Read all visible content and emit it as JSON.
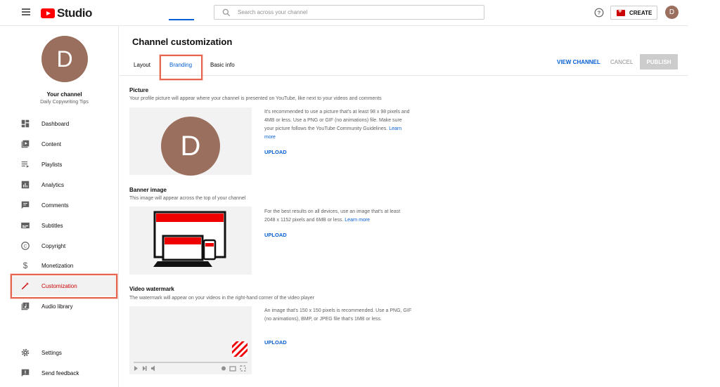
{
  "header": {
    "logo_text": "Studio",
    "search_placeholder": "Search across your channel",
    "create_label": "CREATE",
    "avatar_letter": "D"
  },
  "sidebar": {
    "avatar_letter": "D",
    "your_channel": "Your channel",
    "channel_name": "Daily Copywriting Tips",
    "items": [
      {
        "label": "Dashboard",
        "icon": "dashboard-icon"
      },
      {
        "label": "Content",
        "icon": "content-icon"
      },
      {
        "label": "Playlists",
        "icon": "playlists-icon"
      },
      {
        "label": "Analytics",
        "icon": "analytics-icon"
      },
      {
        "label": "Comments",
        "icon": "comments-icon"
      },
      {
        "label": "Subtitles",
        "icon": "subtitles-icon"
      },
      {
        "label": "Copyright",
        "icon": "copyright-icon"
      },
      {
        "label": "Monetization",
        "icon": "monetization-icon"
      },
      {
        "label": "Customization",
        "icon": "customization-icon",
        "active": true
      },
      {
        "label": "Audio library",
        "icon": "audio-library-icon"
      }
    ],
    "bottom_items": [
      {
        "label": "Settings",
        "icon": "gear-icon"
      },
      {
        "label": "Send feedback",
        "icon": "feedback-icon"
      }
    ]
  },
  "main": {
    "title": "Channel customization",
    "tabs": [
      {
        "label": "Layout"
      },
      {
        "label": "Branding",
        "active": true
      },
      {
        "label": "Basic info"
      }
    ],
    "actions": {
      "view_channel": "VIEW CHANNEL",
      "cancel": "CANCEL",
      "publish": "PUBLISH"
    },
    "picture": {
      "title": "Picture",
      "desc": "Your profile picture will appear where your channel is presented on YouTube, like next to your videos and comments",
      "avatar_letter": "D",
      "info": "It's recommended to use a picture that's at least 98 x 98 pixels and 4MB or less. Use a PNG or GIF (no animations) file. Make sure your picture follows the YouTube Community Guidelines.",
      "learn_more": "Learn more",
      "upload": "UPLOAD"
    },
    "banner": {
      "title": "Banner image",
      "desc": "This image will appear across the top of your channel",
      "info": "For the best results on all devices, use an image that's at least 2048 x 1152 pixels and 6MB or less.",
      "learn_more": "Learn more",
      "upload": "UPLOAD"
    },
    "watermark": {
      "title": "Video watermark",
      "desc": "The watermark will appear on your videos in the right-hand corner of the video player",
      "info": "An image that's 150 x 150 pixels is recommended. Use a PNG, GIF (no animations), BMP, or JPEG file that's 1MB or less.",
      "upload": "UPLOAD"
    }
  },
  "colors": {
    "accent": "#065fd4",
    "brand_red": "#ff0000",
    "highlight": "#e8664f",
    "avatar": "#9a6f5e"
  }
}
